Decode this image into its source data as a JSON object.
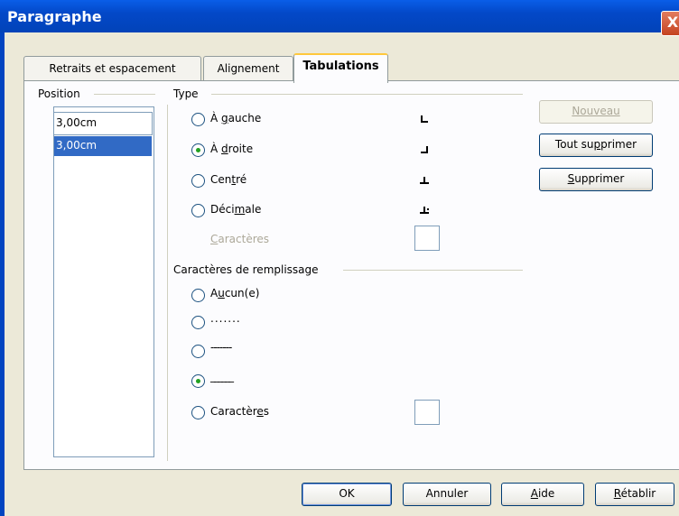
{
  "window": {
    "title": "Paragraphe",
    "close_label": "X"
  },
  "tabs": [
    {
      "label": "Retraits et espacement"
    },
    {
      "label": "Alignement"
    },
    {
      "label": "Tabulations"
    }
  ],
  "position": {
    "heading": "Position",
    "input_value": "3,00cm",
    "list": [
      "3,00cm"
    ]
  },
  "type": {
    "heading": "Type",
    "options": [
      {
        "label": "À gauche",
        "checked": false
      },
      {
        "label": "À droite",
        "checked": true
      },
      {
        "label": "Centré",
        "checked": false
      },
      {
        "label": "Décimale",
        "checked": false
      }
    ],
    "caracteres_label": "Caractères"
  },
  "fill": {
    "heading": "Caractères de remplissage",
    "options": [
      {
        "label": "Aucun(e)",
        "checked": false
      },
      {
        "label": ".......",
        "checked": false
      },
      {
        "label": "-------",
        "checked": false
      },
      {
        "label": "______",
        "checked": true
      },
      {
        "label": "Caractères",
        "checked": false
      }
    ]
  },
  "side_buttons": {
    "new": "Nouveau",
    "delete_all": "Tout supprimer",
    "delete": "Supprimer"
  },
  "footer": {
    "ok": "OK",
    "cancel": "Annuler",
    "help": "Aide",
    "reset": "Rétablir"
  }
}
